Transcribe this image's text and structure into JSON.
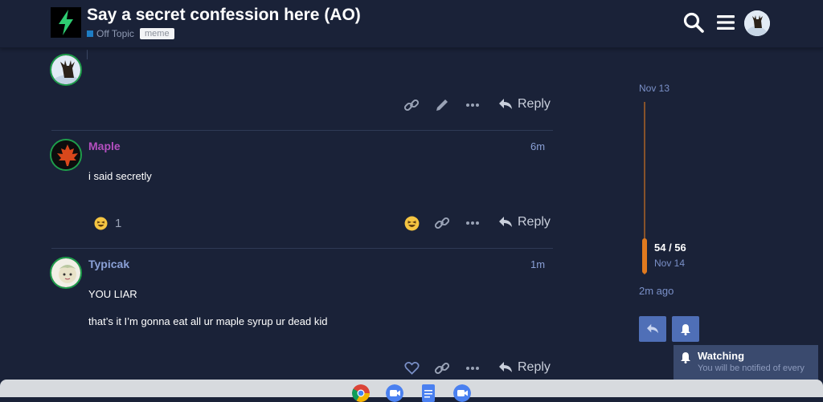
{
  "topic": {
    "title": "Say a secret confession here (AO)",
    "category": "Off Topic",
    "tag": "meme"
  },
  "posts": [
    {
      "author": "Maple",
      "time": "6m",
      "lines": [
        "i said secretly"
      ],
      "reaction_count": "1",
      "reply_label": "Reply"
    },
    {
      "author": "Typicak",
      "time": "1m",
      "lines": [
        "YOU LIAR",
        "that’s it I’m gonna eat all ur maple syrup ur dead kid"
      ],
      "reply_label": "Reply"
    }
  ],
  "first_reply_label": "Reply",
  "timeline": {
    "start_date": "Nov 13",
    "position": "54 / 56",
    "current_date": "Nov 14",
    "last_activity": "2m ago"
  },
  "notification": {
    "level": "Watching",
    "description": "You will be notified of every"
  },
  "colors": {
    "background": "#1a2238",
    "accent": "#e07a1f",
    "author_maple": "#b44fbf",
    "author_typicak": "#8aa0d6",
    "button": "#4f6fb7"
  }
}
